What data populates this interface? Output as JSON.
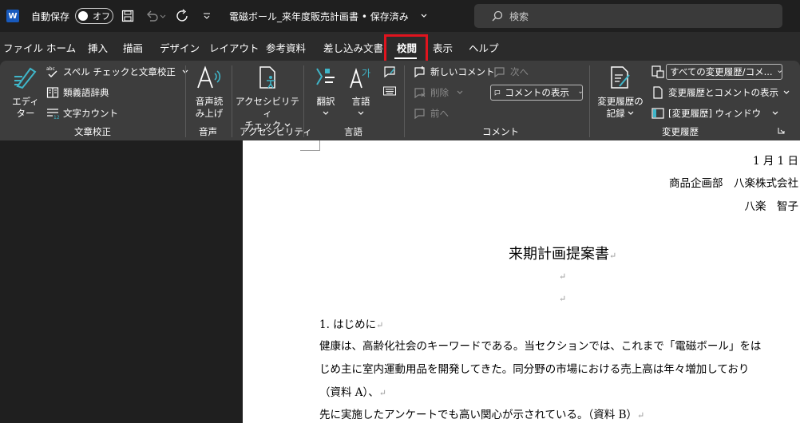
{
  "titlebar": {
    "logo": "W",
    "autosave_label": "自動保存",
    "autosave_state": "オフ",
    "doc_title": "電磁ボール_来年度販売計画書 • 保存済み",
    "search_placeholder": "検索"
  },
  "menu_tabs": [
    "ファイル",
    "ホーム",
    "挿入",
    "描画",
    "デザイン",
    "レイアウト",
    "参考資料",
    "差し込み文書",
    "校閲",
    "表示",
    "ヘルプ"
  ],
  "active_tab": "校閲",
  "ribbon": {
    "proofing": {
      "editor_line1": "エディ",
      "editor_line2": "ター",
      "spell": "スペル チェックと文章校正",
      "thesaurus": "類義語辞典",
      "wordcount": "文字カウント",
      "group": "文章校正"
    },
    "speech": {
      "line1": "音声読",
      "line2": "み上げ",
      "group": "音声"
    },
    "accessibility": {
      "line1": "アクセシビリティ",
      "line2": "チェック",
      "group": "アクセシビリティ"
    },
    "language": {
      "translate": "翻訳",
      "language": "言語",
      "group": "言語"
    },
    "comments": {
      "new": "新しいコメント",
      "delete": "削除",
      "prev": "前へ",
      "next": "次へ",
      "show": "コメントの表示",
      "group": "コメント"
    },
    "tracking": {
      "track_line1": "変更履歴の",
      "track_line2": "記録",
      "all_markup": "すべての変更履歴/コメ...",
      "show_markup": "変更履歴とコメントの表示",
      "pane": "[変更履歴] ウィンドウ",
      "group": "変更履歴"
    }
  },
  "document": {
    "date": "1 月 1 日",
    "dept": "商品企画部　八楽株式会社",
    "author": "八楽　智子",
    "title": "来期計画提案書",
    "heading1": "1. はじめに",
    "para1_line1": "健康は、高齢化社会のキーワードである。当セクションでは、これまで「電磁ボール」をは",
    "para1_line2": "じめ主に室内運動用品を開発してきた。同分野の市場における売上高は年々増加しており",
    "para1_line3": "（資料 A）、",
    "para2_line1": "先に実施したアンケートでも高い関心が示されている。（資料 B）",
    "return_mark": "↵"
  },
  "colors": {
    "titlebar": "#1f1f1f",
    "ribbon": "#3d3d3d",
    "highlight": "#e0141e",
    "word_blue": "#185abd",
    "accent_teal": "#3fb6c9"
  }
}
